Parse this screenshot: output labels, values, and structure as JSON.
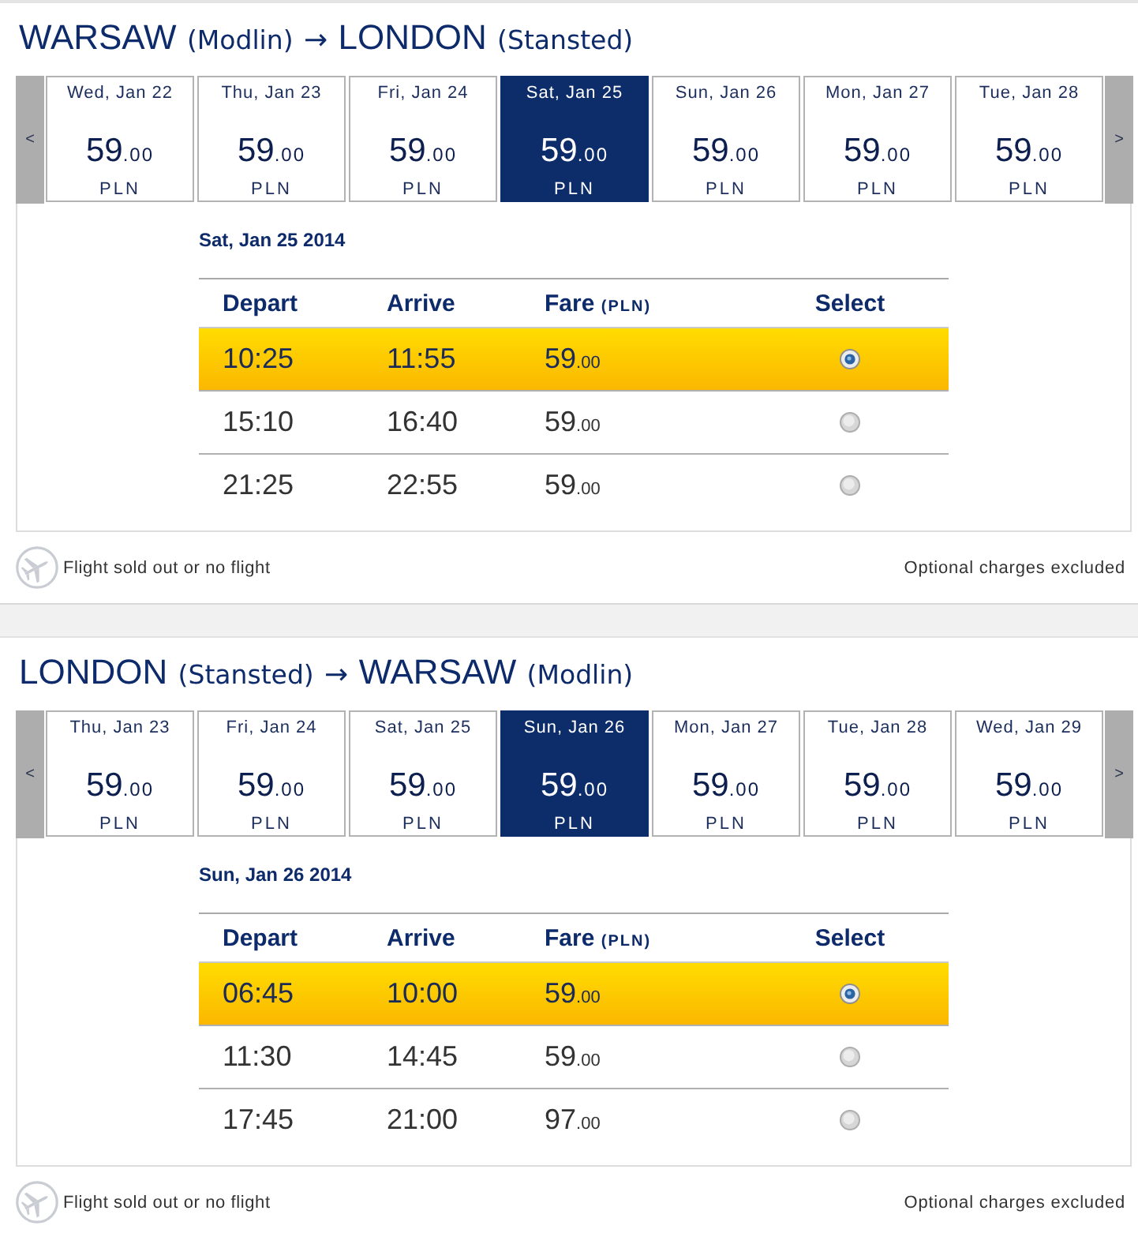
{
  "journeys": [
    {
      "route": {
        "origin_city": "WARSAW",
        "origin_airport": "(Modlin)",
        "arrow": "→",
        "destination_city": "LONDON",
        "destination_airport": "(Stansted)"
      },
      "date_strip": {
        "previous": "<",
        "next": ">",
        "dates": [
          {
            "label": "Wed, Jan 22",
            "price": "59",
            "cents": ".00",
            "currency": "PLN",
            "selected": false
          },
          {
            "label": "Thu, Jan 23",
            "price": "59",
            "cents": ".00",
            "currency": "PLN",
            "selected": false
          },
          {
            "label": "Fri, Jan 24",
            "price": "59",
            "cents": ".00",
            "currency": "PLN",
            "selected": false
          },
          {
            "label": "Sat, Jan 25",
            "price": "59",
            "cents": ".00",
            "currency": "PLN",
            "selected": true
          },
          {
            "label": "Sun, Jan 26",
            "price": "59",
            "cents": ".00",
            "currency": "PLN",
            "selected": false
          },
          {
            "label": "Mon, Jan 27",
            "price": "59",
            "cents": ".00",
            "currency": "PLN",
            "selected": false
          },
          {
            "label": "Tue, Jan 28",
            "price": "59",
            "cents": ".00",
            "currency": "PLN",
            "selected": false
          }
        ]
      },
      "selected_date": "Sat, Jan 25 2014",
      "flights": {
        "columns": [
          {
            "label": "Depart"
          },
          {
            "label": "Arrive"
          },
          {
            "label": "Fare",
            "unit": "(PLN)"
          },
          {
            "label": "Select"
          }
        ],
        "rows": [
          {
            "depart": "10:25",
            "arrive": "11:55",
            "fare": "59",
            "cents": ".00",
            "selected": true
          },
          {
            "depart": "15:10",
            "arrive": "16:40",
            "fare": "59",
            "cents": ".00",
            "selected": false
          },
          {
            "depart": "21:25",
            "arrive": "22:55",
            "fare": "59",
            "cents": ".00",
            "selected": false
          }
        ]
      },
      "legend": "Flight sold out or no flight",
      "note": "Optional charges excluded"
    },
    {
      "route": {
        "origin_city": "LONDON",
        "origin_airport": "(Stansted)",
        "arrow": "→",
        "destination_city": "WARSAW",
        "destination_airport": "(Modlin)"
      },
      "date_strip": {
        "previous": "<",
        "next": ">",
        "dates": [
          {
            "label": "Thu, Jan 23",
            "price": "59",
            "cents": ".00",
            "currency": "PLN",
            "selected": false
          },
          {
            "label": "Fri, Jan 24",
            "price": "59",
            "cents": ".00",
            "currency": "PLN",
            "selected": false
          },
          {
            "label": "Sat, Jan 25",
            "price": "59",
            "cents": ".00",
            "currency": "PLN",
            "selected": false
          },
          {
            "label": "Sun, Jan 26",
            "price": "59",
            "cents": ".00",
            "currency": "PLN",
            "selected": true
          },
          {
            "label": "Mon, Jan 27",
            "price": "59",
            "cents": ".00",
            "currency": "PLN",
            "selected": false
          },
          {
            "label": "Tue, Jan 28",
            "price": "59",
            "cents": ".00",
            "currency": "PLN",
            "selected": false
          },
          {
            "label": "Wed, Jan 29",
            "price": "59",
            "cents": ".00",
            "currency": "PLN",
            "selected": false
          }
        ]
      },
      "selected_date": "Sun, Jan 26 2014",
      "flights": {
        "columns": [
          {
            "label": "Depart"
          },
          {
            "label": "Arrive"
          },
          {
            "label": "Fare",
            "unit": "(PLN)"
          },
          {
            "label": "Select"
          }
        ],
        "rows": [
          {
            "depart": "06:45",
            "arrive": "10:00",
            "fare": "59",
            "cents": ".00",
            "selected": true
          },
          {
            "depart": "11:30",
            "arrive": "14:45",
            "fare": "59",
            "cents": ".00",
            "selected": false
          },
          {
            "depart": "17:45",
            "arrive": "21:00",
            "fare": "97",
            "cents": ".00",
            "selected": false
          }
        ]
      },
      "legend": "Flight sold out or no flight",
      "note": "Optional charges excluded"
    }
  ]
}
